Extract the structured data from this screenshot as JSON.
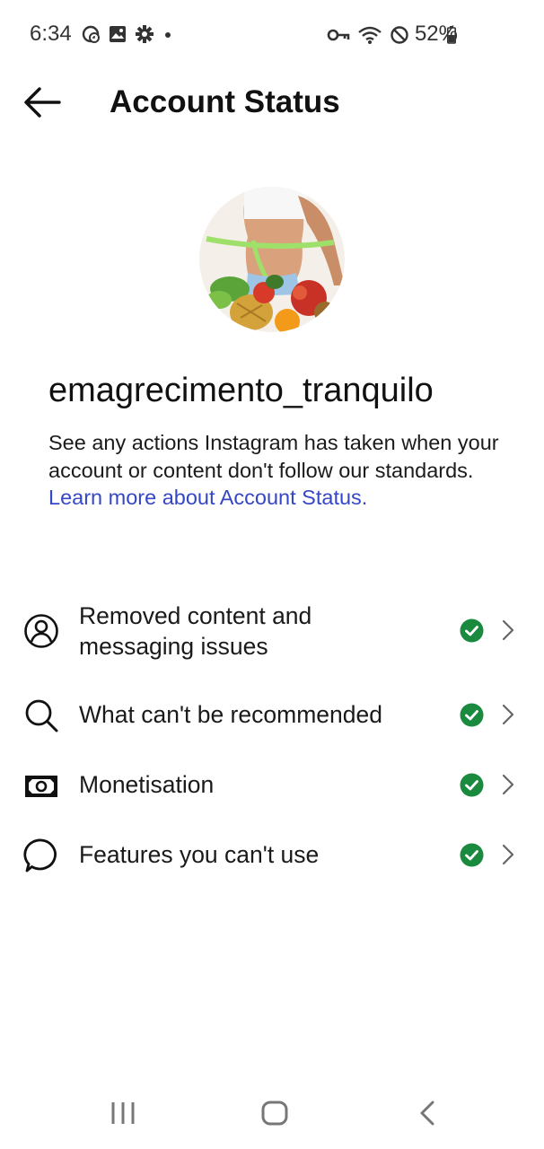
{
  "status_bar": {
    "time": "6:34",
    "battery": "52%",
    "left_icons": [
      "whatsapp-icon",
      "gallery-icon",
      "settings-icon",
      "dot-icon"
    ],
    "right_icons": [
      "vpn-key-icon",
      "wifi-icon",
      "do-not-disturb-icon",
      "battery-icon"
    ]
  },
  "header": {
    "title": "Account Status",
    "back_icon": "arrow-left-icon"
  },
  "profile": {
    "username": "emagrecimento_tranquilo"
  },
  "description": {
    "text": "See any actions Instagram has taken when your account or content don't follow our standards. ",
    "link": "Learn more about Account Status."
  },
  "colors": {
    "link": "#3547c4",
    "check_green": "#1a8a3f"
  },
  "items": [
    {
      "label": "Removed content and messaging issues",
      "icon": "user-circle-icon",
      "status": "ok"
    },
    {
      "label": "What can't be recommended",
      "icon": "search-icon",
      "status": "ok"
    },
    {
      "label": "Monetisation",
      "icon": "banknote-icon",
      "status": "ok"
    },
    {
      "label": "Features you can't use",
      "icon": "speech-bubble-icon",
      "status": "ok"
    }
  ],
  "nav_bar": {
    "buttons": [
      "recents-icon",
      "home-icon",
      "back-icon"
    ]
  }
}
